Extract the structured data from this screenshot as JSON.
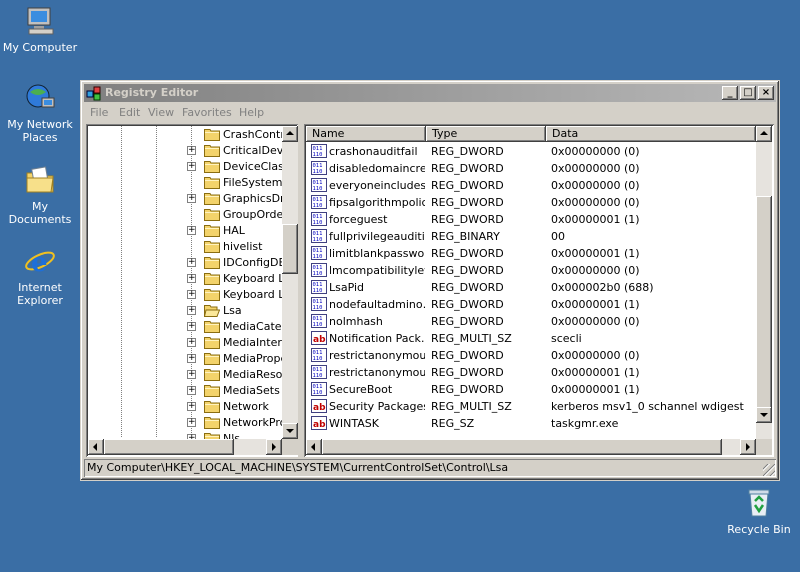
{
  "desktop": {
    "icons": [
      {
        "label": "My Computer"
      },
      {
        "label": "My Network Places"
      },
      {
        "label": "My Documents"
      },
      {
        "label": "Internet Explorer"
      },
      {
        "label": "Recycle Bin"
      }
    ]
  },
  "window": {
    "title": "Registry Editor",
    "controls": {
      "minimize": "_",
      "maximize": "□",
      "close": "×"
    },
    "menu": [
      "File",
      "Edit",
      "View",
      "Favorites",
      "Help"
    ]
  },
  "tree": {
    "items": [
      {
        "label": "CrashControl",
        "expandable": false,
        "open": false
      },
      {
        "label": "CriticalDeviceDatabase",
        "expandable": true,
        "open": false
      },
      {
        "label": "DeviceClasses",
        "expandable": true,
        "open": false
      },
      {
        "label": "FileSystem",
        "expandable": false,
        "open": false
      },
      {
        "label": "GraphicsDrivers",
        "expandable": true,
        "open": false
      },
      {
        "label": "GroupOrderList",
        "expandable": false,
        "open": false
      },
      {
        "label": "HAL",
        "expandable": true,
        "open": false
      },
      {
        "label": "hivelist",
        "expandable": false,
        "open": false
      },
      {
        "label": "IDConfigDB",
        "expandable": true,
        "open": false
      },
      {
        "label": "Keyboard Layout",
        "expandable": true,
        "open": false
      },
      {
        "label": "Keyboard Layouts",
        "expandable": true,
        "open": false
      },
      {
        "label": "Lsa",
        "expandable": true,
        "open": true
      },
      {
        "label": "MediaCategories",
        "expandable": true,
        "open": false
      },
      {
        "label": "MediaInterfaces",
        "expandable": true,
        "open": false
      },
      {
        "label": "MediaProperties",
        "expandable": true,
        "open": false
      },
      {
        "label": "MediaResources",
        "expandable": true,
        "open": false
      },
      {
        "label": "MediaSets",
        "expandable": true,
        "open": false
      },
      {
        "label": "Network",
        "expandable": true,
        "open": false
      },
      {
        "label": "NetworkProvider",
        "expandable": true,
        "open": false
      },
      {
        "label": "Nls",
        "expandable": true,
        "open": false
      }
    ]
  },
  "list": {
    "columns": [
      "Name",
      "Type",
      "Data"
    ],
    "rows": [
      {
        "icon": "dword",
        "name": "crashonauditfail",
        "type": "REG_DWORD",
        "data": "0x00000000 (0)"
      },
      {
        "icon": "dword",
        "name": "disabledomaincreds",
        "type": "REG_DWORD",
        "data": "0x00000000 (0)"
      },
      {
        "icon": "dword",
        "name": "everyoneincludes…",
        "type": "REG_DWORD",
        "data": "0x00000000 (0)"
      },
      {
        "icon": "dword",
        "name": "fipsalgorithmpolicy",
        "type": "REG_DWORD",
        "data": "0x00000000 (0)"
      },
      {
        "icon": "dword",
        "name": "forceguest",
        "type": "REG_DWORD",
        "data": "0x00000001 (1)"
      },
      {
        "icon": "dword",
        "name": "fullprivilegeauditing",
        "type": "REG_BINARY",
        "data": "00"
      },
      {
        "icon": "dword",
        "name": "limitblankpasswor…",
        "type": "REG_DWORD",
        "data": "0x00000001 (1)"
      },
      {
        "icon": "dword",
        "name": "lmcompatibilitylevel",
        "type": "REG_DWORD",
        "data": "0x00000000 (0)"
      },
      {
        "icon": "dword",
        "name": "LsaPid",
        "type": "REG_DWORD",
        "data": "0x000002b0 (688)"
      },
      {
        "icon": "dword",
        "name": "nodefaultadmino…",
        "type": "REG_DWORD",
        "data": "0x00000001 (1)"
      },
      {
        "icon": "dword",
        "name": "nolmhash",
        "type": "REG_DWORD",
        "data": "0x00000000 (0)"
      },
      {
        "icon": "string",
        "name": "Notification Pack…",
        "type": "REG_MULTI_SZ",
        "data": "scecli"
      },
      {
        "icon": "dword",
        "name": "restrictanonymous",
        "type": "REG_DWORD",
        "data": "0x00000000 (0)"
      },
      {
        "icon": "dword",
        "name": "restrictanonymou…",
        "type": "REG_DWORD",
        "data": "0x00000001 (1)"
      },
      {
        "icon": "dword",
        "name": "SecureBoot",
        "type": "REG_DWORD",
        "data": "0x00000001 (1)"
      },
      {
        "icon": "string",
        "name": "Security Packages",
        "type": "REG_MULTI_SZ",
        "data": "kerberos msv1_0 schannel wdigest"
      },
      {
        "icon": "string",
        "name": "WINTASK",
        "type": "REG_SZ",
        "data": "taskgmr.exe"
      }
    ]
  },
  "statusbar": {
    "path": "My Computer\\HKEY_LOCAL_MACHINE\\SYSTEM\\CurrentControlSet\\Control\\Lsa"
  },
  "colors": {
    "desktop": "#3a6ea5",
    "titlebar_inactive": "#808080",
    "chrome": "#d4d0c8"
  }
}
